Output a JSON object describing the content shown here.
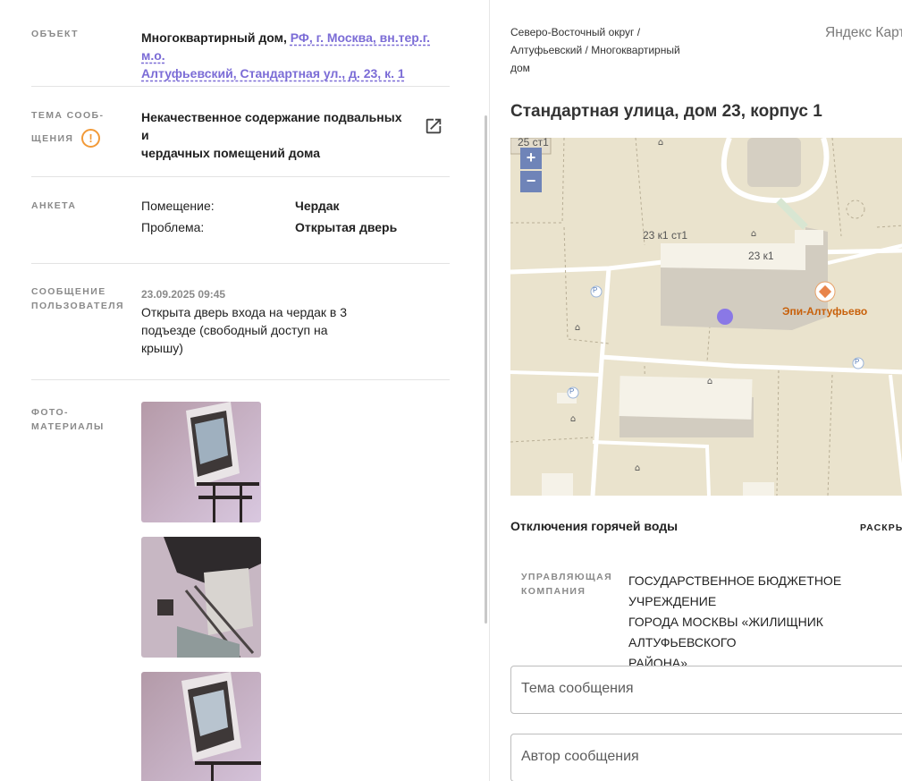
{
  "left": {
    "object": {
      "label": "ОБЪЕКТ",
      "type_text": "Многоквартирный дом,",
      "address_line1": "РФ, г. Москва, вн.тер.г. м.о.",
      "address_line2": "Алтуфьевский, Стандартная ул., д. 23, к. 1"
    },
    "topic": {
      "label_line1": "ТЕМА СООБ-",
      "label_line2": "ЩЕНИЯ",
      "text_line1": "Некачественное содержание подвальных и",
      "text_line2": "чердачных помещений дома",
      "warning_icon": "exclamation-circle-icon",
      "open_icon": "open-in-new-icon"
    },
    "survey": {
      "label": "АНКЕТА",
      "items": [
        {
          "key": "Помещение:",
          "value": "Чердак"
        },
        {
          "key": "Проблема:",
          "value": "Открытая дверь"
        }
      ]
    },
    "user_message": {
      "label_line1": "СООБЩЕНИЕ",
      "label_line2": "ПОЛЬЗОВАТЕЛЯ",
      "datetime": "23.09.2025 09:45",
      "text_line1": "Открыта дверь входа на чердак в 3",
      "text_line2": "подъезде (свободный доступ на",
      "text_line3": "крышу)"
    },
    "photos": {
      "label_line1": "ФОТО-",
      "label_line2": "МАТЕРИАЛЫ",
      "count": 3
    }
  },
  "right": {
    "breadcrumb_line1": "Северо-Восточный округ /",
    "breadcrumb_line2": "Алтуфьевский / Многоквартирный",
    "breadcrumb_line3": "дом",
    "map_provider": "Яндекс Карты",
    "address_title": "Стандартная улица, дом 23, корпус 1",
    "map": {
      "zoom_in": "+",
      "zoom_out": "−",
      "labels": {
        "l1": "25 ст1",
        "l2": "23 к1 ст1",
        "l3": "23 к1",
        "poi": "Эпи-Алтуфьево",
        "parking": "P"
      }
    },
    "hot_water": {
      "title": "Отключения горячей воды",
      "expand": "РАСКРЫТЬ"
    },
    "management": {
      "label_line1": "УПРАВЛЯЮЩАЯ",
      "label_line2": "КОМПАНИЯ",
      "line1": "ГОСУДАРСТВЕННОЕ БЮДЖЕТНОЕ УЧРЕЖДЕНИЕ",
      "line2": "ГОРОДА МОСКВЫ «ЖИЛИЩНИК АЛТУФЬЕВСКОГО",
      "line3": "РАЙОНА»"
    },
    "form": {
      "topic_placeholder": "Тема сообщения",
      "author_placeholder": "Автор сообщения"
    }
  },
  "colors": {
    "link": "#7b6cd6",
    "warning": "#f29a38",
    "map_bg": "#eae3cd",
    "zoom_btn": "#6f84b8"
  }
}
